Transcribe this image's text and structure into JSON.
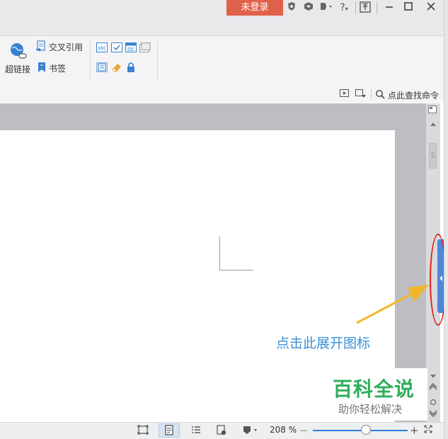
{
  "titlebar": {
    "login_label": "未登录",
    "help_label": "?",
    "icons": [
      "skin-icon",
      "cube-icon",
      "share-icon",
      "help-icon",
      "upload-icon",
      "minimize-icon",
      "maximize-icon",
      "close-icon"
    ]
  },
  "ribbon": {
    "hyperlink_label": "超链接",
    "cross_ref_label": "交叉引用",
    "bookmark_label": "书签",
    "search_label": "点此查找命令"
  },
  "document": {
    "hint_text": "点击此展开图标"
  },
  "watermark": {
    "title": "百科全说",
    "subtitle": "助你轻松解决"
  },
  "statusbar": {
    "zoom_text": "208 %",
    "zoom_minus": "—",
    "zoom_plus": "+",
    "zoom_level": 0.56
  },
  "colors": {
    "login_bg": "#e0614a",
    "expand_tab": "#4f86d6",
    "highlight_ring": "#e02020",
    "hint_text": "#3b8fd6",
    "watermark_green": "#2fae5b",
    "zoom_track": "#2e7fd8"
  }
}
